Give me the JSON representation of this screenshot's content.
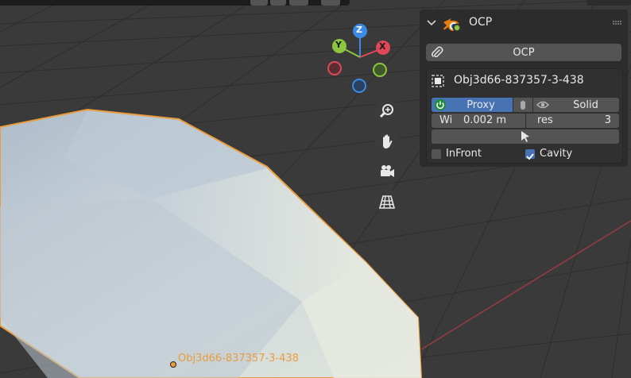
{
  "panel": {
    "title": "OCP",
    "ocp_button_label": "OCP",
    "object_name": "Obj3d66-837357-3-438",
    "proxy_label": "Proxy",
    "solid_label": "Solid",
    "wi_label": "Wi",
    "wi_value": "0.002 m",
    "res_label": "res",
    "res_value": "3",
    "infront_label": "InFront",
    "infront_checked": false,
    "cavity_label": "Cavity",
    "cavity_checked": true
  },
  "viewport": {
    "object_label": "Obj3d66-837357-3-438",
    "gizmo": {
      "z": "Z",
      "y": "Y",
      "x": "X"
    },
    "nav_icons": [
      "zoom-icon",
      "hand-pan-icon",
      "camera-icon",
      "grid-perspective-icon"
    ]
  },
  "colors": {
    "accent_blue": "#4772b3",
    "selection_orange": "#e99d3d",
    "axis_x": "#e0485a",
    "axis_y": "#8cc63e",
    "axis_z": "#3b8be6"
  }
}
